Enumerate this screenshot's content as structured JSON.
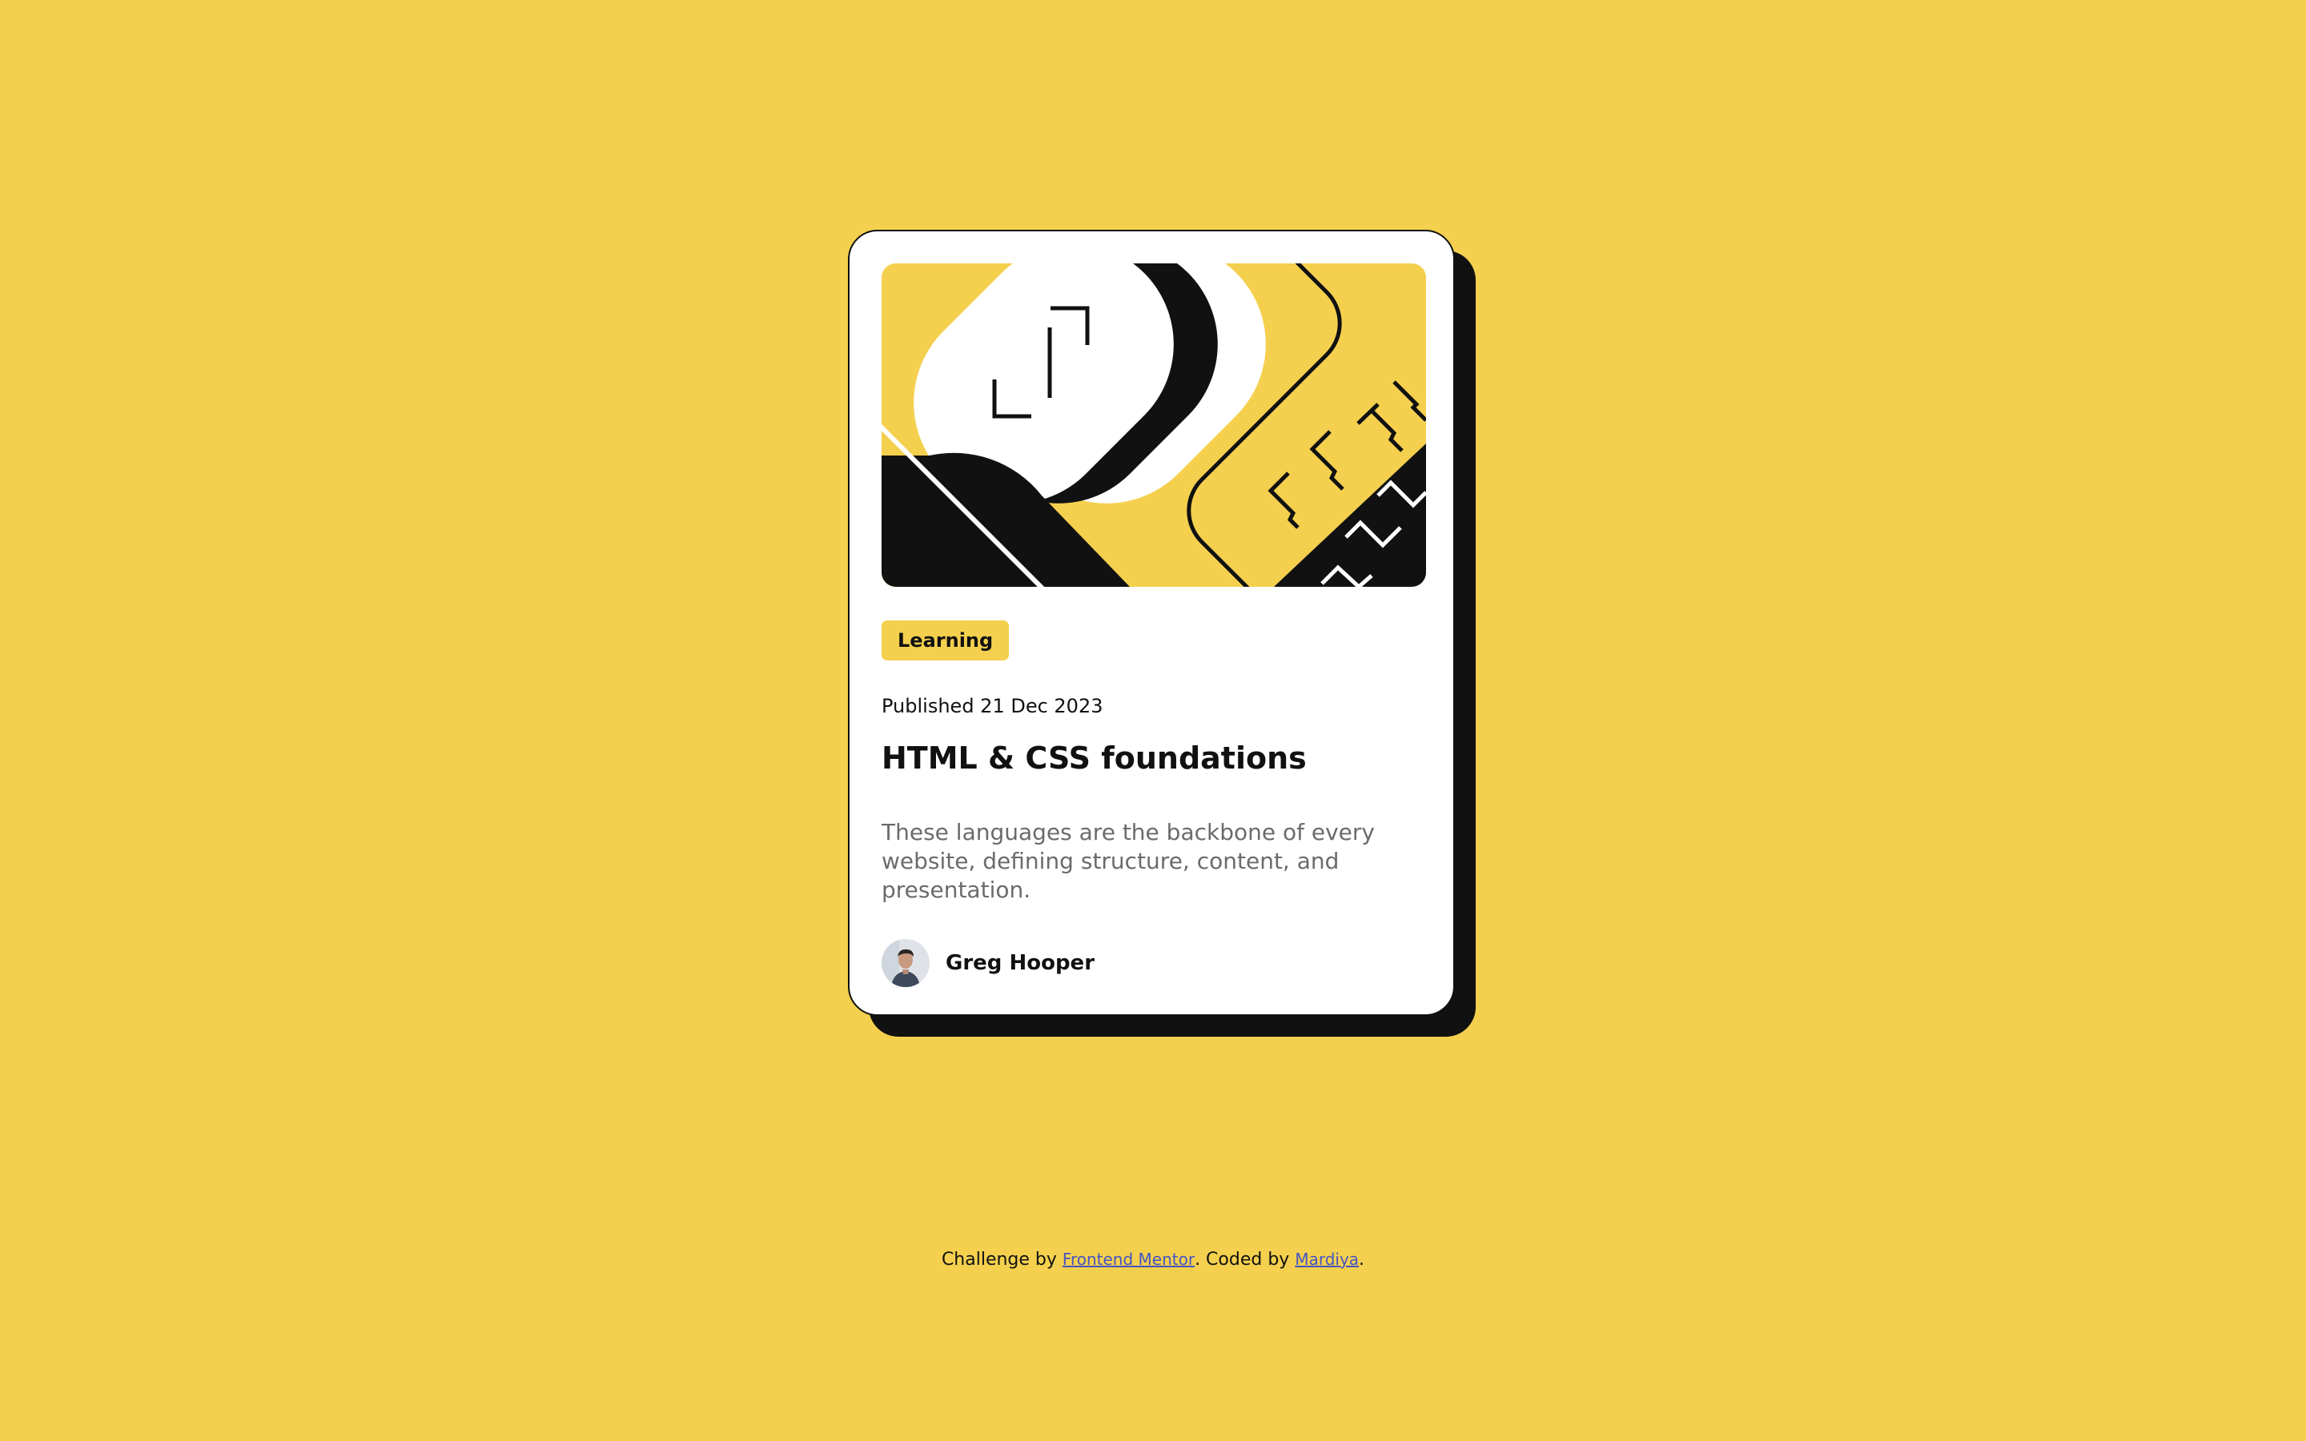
{
  "card": {
    "tag": "Learning",
    "published": "Published 21 Dec 2023",
    "title": "HTML & CSS foundations",
    "description": "These languages are the backbone of every website, defining structure, content, and presentation.",
    "author": "Greg Hooper"
  },
  "attribution": {
    "prefix": "Challenge by",
    "link1": "Frontend Mentor",
    "middle": ". Coded by",
    "link2": "Mardiya",
    "suffix": "."
  },
  "icons": {
    "illustration": "abstract-html-css-illustration",
    "avatar": "greg-hooper-avatar"
  },
  "colors": {
    "background": "#f4d04e",
    "card": "#ffffff",
    "shadow": "#111111",
    "text": "#111111",
    "muted": "#6b6b6b",
    "link": "#4554c1"
  }
}
